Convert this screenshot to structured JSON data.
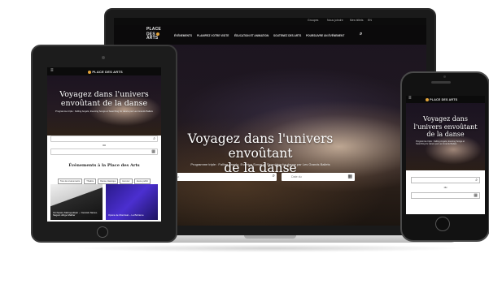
{
  "brand": {
    "logo_text": "PLACE DES ARTS",
    "logo_line1": "PLACE",
    "logo_line2": "DES",
    "logo_line3": "ARTS",
    "accent": "#e3a43a"
  },
  "desktop": {
    "topbar": [
      "Groupes",
      "Nous joindre",
      "Mes billets",
      "EN"
    ],
    "nav": [
      "ÉVÉNEMENTS",
      "PLANIFIEZ VOTRE VISITE",
      "ÉDUCATION ET ANIMATION",
      "SOUTENEZ DES ARTS",
      "POURSUIVRE UN ÉVÉNEMENT"
    ],
    "hero_title_line1": "Voyagez dans l'univers envoûtant",
    "hero_title_line2": "de la danse",
    "hero_subtitle": "Programme triple : Falling Angels, Evening Songs et Searching for dance par Les Grands Ballets",
    "search_placeholder": "Date du",
    "date_placeholder": "Date du"
  },
  "tablet": {
    "hero_title_line1": "Voyagez dans l'univers",
    "hero_title_line2": "envoûtant de la danse",
    "hero_subtitle": "Programme triple : Falling Angels, Evening Songs et Searching for dance par Les Grands Ballets",
    "connector": "ou",
    "section_title": "Événements à la Place des Arts",
    "filters": [
      "Tous les événements",
      "Théâtre",
      "Danse classique",
      "Humour",
      "Jeune public"
    ],
    "card1_text": "Orchestre Métropolitain – Yannick Nézet-Séguin dirige Mahler",
    "card2_text": "Opéra de Montréal – La Bohème"
  },
  "phone": {
    "hero_title_line1": "Voyagez dans",
    "hero_title_line2": "l'univers envoûtant",
    "hero_title_line3": "de la danse",
    "hero_subtitle": "Programme triple : Falling Angels, Evening Songs et Searching for dance par Les Grands Ballets",
    "connector": "ou"
  }
}
